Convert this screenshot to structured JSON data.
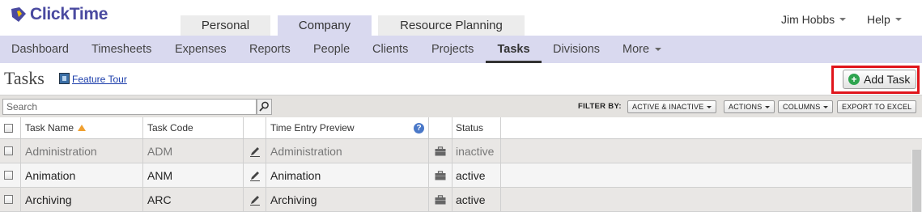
{
  "app": {
    "logo_text": "ClickTime",
    "brand_color": "#4a4aa0",
    "accent_highlight": "#e0151b"
  },
  "main_tabs": [
    {
      "label": "Personal",
      "active": false
    },
    {
      "label": "Company",
      "active": true
    },
    {
      "label": "Resource Planning",
      "active": false
    }
  ],
  "user_menu": {
    "name": "Jim Hobbs",
    "help": "Help"
  },
  "subnav": [
    {
      "label": "Dashboard"
    },
    {
      "label": "Timesheets"
    },
    {
      "label": "Expenses"
    },
    {
      "label": "Reports"
    },
    {
      "label": "People"
    },
    {
      "label": "Clients"
    },
    {
      "label": "Projects"
    },
    {
      "label": "Tasks",
      "active": true
    },
    {
      "label": "Divisions"
    },
    {
      "label": "More"
    }
  ],
  "page": {
    "title": "Tasks",
    "feature_tour": "Feature Tour",
    "add_button": "Add Task"
  },
  "toolbar": {
    "search_placeholder": "Search",
    "filter_label": "FILTER BY:",
    "filter_status": "ACTIVE & INACTIVE",
    "actions": "ACTIONS",
    "columns": "COLUMNS",
    "export": "EXPORT TO EXCEL"
  },
  "table": {
    "columns": [
      "Task Name",
      "Task Code",
      "Time Entry Preview",
      "Status"
    ],
    "rows": [
      {
        "name": "Administration",
        "code": "ADM",
        "preview": "Administration",
        "status": "inactive"
      },
      {
        "name": "Animation",
        "code": "ANM",
        "preview": "Animation",
        "status": "active"
      },
      {
        "name": "Archiving",
        "code": "ARC",
        "preview": "Archiving",
        "status": "active"
      }
    ]
  }
}
